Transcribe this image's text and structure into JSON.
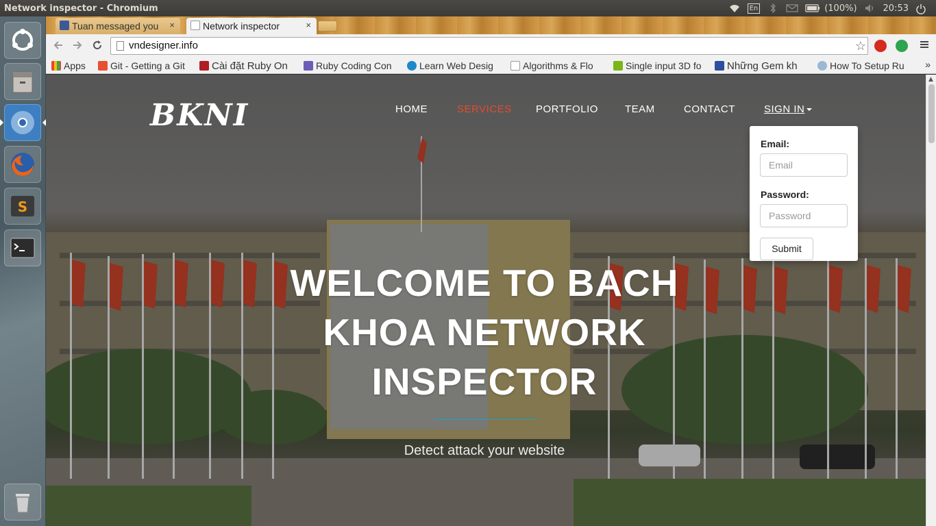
{
  "os_panel": {
    "window_title": "Network inspector - Chromium",
    "lang": "En",
    "battery": "(100%)",
    "clock": "20:53"
  },
  "launcher": {
    "items": [
      "ubuntu-dash",
      "files",
      "chromium",
      "firefox",
      "sublime-text",
      "terminal",
      "trash"
    ]
  },
  "browser": {
    "tabs": [
      {
        "label": "Tuan messaged you",
        "close": "×"
      },
      {
        "label": "Network inspector",
        "close": "×"
      }
    ],
    "url": "vndesigner.info",
    "bookmarks": [
      {
        "label": "Apps",
        "color": "#4285f4"
      },
      {
        "label": "Git - Getting a Git",
        "color": "#e84e31"
      },
      {
        "label": "Cài đặt Ruby On",
        "color": "#b01e23"
      },
      {
        "label": "Ruby Coding Con",
        "color": "#6b5fb5"
      },
      {
        "label": "Learn Web Desig",
        "color": "#1e88c9"
      },
      {
        "label": "Algorithms & Flo",
        "color": "#ffffff"
      },
      {
        "label": "Single input 3D fo",
        "color": "#7cb518"
      },
      {
        "label": "Những Gem kh",
        "color": "#2b4f9e"
      },
      {
        "label": "How To Setup Ru",
        "color": "#9bb8d3"
      }
    ],
    "bookmarks_more": "»"
  },
  "site": {
    "brand": "BKNI",
    "nav": [
      {
        "label": "HOME"
      },
      {
        "label": "SERVICES"
      },
      {
        "label": "PORTFOLIO"
      },
      {
        "label": "TEAM"
      },
      {
        "label": "CONTACT"
      },
      {
        "label": "SIGN IN"
      }
    ],
    "accent_color": "#e64a2e",
    "signin": {
      "email_label": "Email:",
      "email_placeholder": "Email",
      "password_label": "Password:",
      "password_placeholder": "Password",
      "submit_label": "Submit"
    },
    "hero": {
      "title": "WELCOME TO BACH KHOA NETWORK INSPECTOR",
      "subtitle": "Detect attack your website",
      "divider_color": "#1ba1c9"
    }
  }
}
